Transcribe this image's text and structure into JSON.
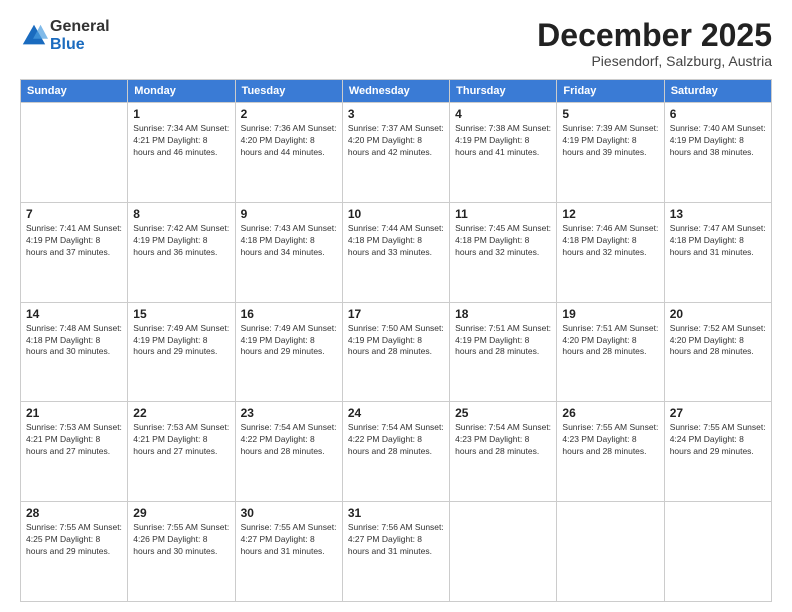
{
  "logo": {
    "general": "General",
    "blue": "Blue"
  },
  "header": {
    "month": "December 2025",
    "location": "Piesendorf, Salzburg, Austria"
  },
  "weekdays": [
    "Sunday",
    "Monday",
    "Tuesday",
    "Wednesday",
    "Thursday",
    "Friday",
    "Saturday"
  ],
  "weeks": [
    [
      {
        "day": "",
        "info": ""
      },
      {
        "day": "1",
        "info": "Sunrise: 7:34 AM\nSunset: 4:21 PM\nDaylight: 8 hours\nand 46 minutes."
      },
      {
        "day": "2",
        "info": "Sunrise: 7:36 AM\nSunset: 4:20 PM\nDaylight: 8 hours\nand 44 minutes."
      },
      {
        "day": "3",
        "info": "Sunrise: 7:37 AM\nSunset: 4:20 PM\nDaylight: 8 hours\nand 42 minutes."
      },
      {
        "day": "4",
        "info": "Sunrise: 7:38 AM\nSunset: 4:19 PM\nDaylight: 8 hours\nand 41 minutes."
      },
      {
        "day": "5",
        "info": "Sunrise: 7:39 AM\nSunset: 4:19 PM\nDaylight: 8 hours\nand 39 minutes."
      },
      {
        "day": "6",
        "info": "Sunrise: 7:40 AM\nSunset: 4:19 PM\nDaylight: 8 hours\nand 38 minutes."
      }
    ],
    [
      {
        "day": "7",
        "info": "Sunrise: 7:41 AM\nSunset: 4:19 PM\nDaylight: 8 hours\nand 37 minutes."
      },
      {
        "day": "8",
        "info": "Sunrise: 7:42 AM\nSunset: 4:19 PM\nDaylight: 8 hours\nand 36 minutes."
      },
      {
        "day": "9",
        "info": "Sunrise: 7:43 AM\nSunset: 4:18 PM\nDaylight: 8 hours\nand 34 minutes."
      },
      {
        "day": "10",
        "info": "Sunrise: 7:44 AM\nSunset: 4:18 PM\nDaylight: 8 hours\nand 33 minutes."
      },
      {
        "day": "11",
        "info": "Sunrise: 7:45 AM\nSunset: 4:18 PM\nDaylight: 8 hours\nand 32 minutes."
      },
      {
        "day": "12",
        "info": "Sunrise: 7:46 AM\nSunset: 4:18 PM\nDaylight: 8 hours\nand 32 minutes."
      },
      {
        "day": "13",
        "info": "Sunrise: 7:47 AM\nSunset: 4:18 PM\nDaylight: 8 hours\nand 31 minutes."
      }
    ],
    [
      {
        "day": "14",
        "info": "Sunrise: 7:48 AM\nSunset: 4:18 PM\nDaylight: 8 hours\nand 30 minutes."
      },
      {
        "day": "15",
        "info": "Sunrise: 7:49 AM\nSunset: 4:19 PM\nDaylight: 8 hours\nand 29 minutes."
      },
      {
        "day": "16",
        "info": "Sunrise: 7:49 AM\nSunset: 4:19 PM\nDaylight: 8 hours\nand 29 minutes."
      },
      {
        "day": "17",
        "info": "Sunrise: 7:50 AM\nSunset: 4:19 PM\nDaylight: 8 hours\nand 28 minutes."
      },
      {
        "day": "18",
        "info": "Sunrise: 7:51 AM\nSunset: 4:19 PM\nDaylight: 8 hours\nand 28 minutes."
      },
      {
        "day": "19",
        "info": "Sunrise: 7:51 AM\nSunset: 4:20 PM\nDaylight: 8 hours\nand 28 minutes."
      },
      {
        "day": "20",
        "info": "Sunrise: 7:52 AM\nSunset: 4:20 PM\nDaylight: 8 hours\nand 28 minutes."
      }
    ],
    [
      {
        "day": "21",
        "info": "Sunrise: 7:53 AM\nSunset: 4:21 PM\nDaylight: 8 hours\nand 27 minutes."
      },
      {
        "day": "22",
        "info": "Sunrise: 7:53 AM\nSunset: 4:21 PM\nDaylight: 8 hours\nand 27 minutes."
      },
      {
        "day": "23",
        "info": "Sunrise: 7:54 AM\nSunset: 4:22 PM\nDaylight: 8 hours\nand 28 minutes."
      },
      {
        "day": "24",
        "info": "Sunrise: 7:54 AM\nSunset: 4:22 PM\nDaylight: 8 hours\nand 28 minutes."
      },
      {
        "day": "25",
        "info": "Sunrise: 7:54 AM\nSunset: 4:23 PM\nDaylight: 8 hours\nand 28 minutes."
      },
      {
        "day": "26",
        "info": "Sunrise: 7:55 AM\nSunset: 4:23 PM\nDaylight: 8 hours\nand 28 minutes."
      },
      {
        "day": "27",
        "info": "Sunrise: 7:55 AM\nSunset: 4:24 PM\nDaylight: 8 hours\nand 29 minutes."
      }
    ],
    [
      {
        "day": "28",
        "info": "Sunrise: 7:55 AM\nSunset: 4:25 PM\nDaylight: 8 hours\nand 29 minutes."
      },
      {
        "day": "29",
        "info": "Sunrise: 7:55 AM\nSunset: 4:26 PM\nDaylight: 8 hours\nand 30 minutes."
      },
      {
        "day": "30",
        "info": "Sunrise: 7:55 AM\nSunset: 4:27 PM\nDaylight: 8 hours\nand 31 minutes."
      },
      {
        "day": "31",
        "info": "Sunrise: 7:56 AM\nSunset: 4:27 PM\nDaylight: 8 hours\nand 31 minutes."
      },
      {
        "day": "",
        "info": ""
      },
      {
        "day": "",
        "info": ""
      },
      {
        "day": "",
        "info": ""
      }
    ]
  ]
}
